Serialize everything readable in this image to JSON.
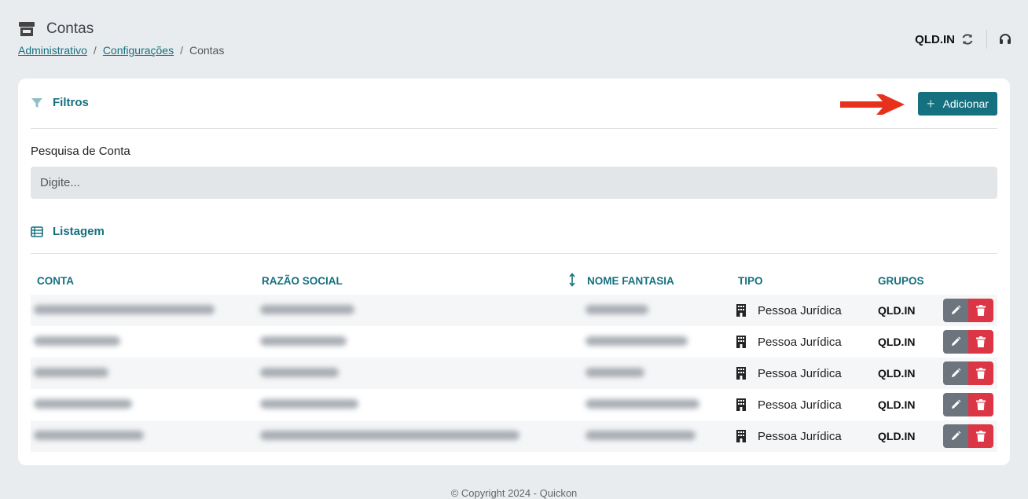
{
  "page": {
    "title": "Contas",
    "breadcrumb": [
      {
        "label": "Administrativo"
      },
      {
        "label": "Configurações"
      },
      {
        "label": "Contas"
      }
    ],
    "breadcrumb_separator": "/"
  },
  "top_right": {
    "org": "QLD.IN"
  },
  "filters": {
    "heading": "Filtros",
    "add_button": "Adicionar",
    "search_label": "Pesquisa de Conta",
    "search_placeholder": "Digite..."
  },
  "listing": {
    "heading": "Listagem",
    "columns": [
      "CONTA",
      "RAZÃO SOCIAL",
      "NOME FANTASIA",
      "TIPO",
      "GRUPOS"
    ],
    "rows": [
      {
        "tipo": "Pessoa Jurídica",
        "grupo": "QLD.IN"
      },
      {
        "tipo": "Pessoa Jurídica",
        "grupo": "QLD.IN"
      },
      {
        "tipo": "Pessoa Jurídica",
        "grupo": "QLD.IN"
      },
      {
        "tipo": "Pessoa Jurídica",
        "grupo": "QLD.IN"
      },
      {
        "tipo": "Pessoa Jurídica",
        "grupo": "QLD.IN"
      }
    ]
  },
  "footer": {
    "text": "© Copyright 2024 - Quickon"
  },
  "colors": {
    "accent": "#15707f",
    "delete": "#dc3545",
    "edit": "#6c757d",
    "arrow": "#e8311c",
    "background": "#e9ecef"
  },
  "icons": [
    "store-icon",
    "refresh-icon",
    "support-icon",
    "filter-icon",
    "list-icon",
    "sort-icon",
    "building-icon",
    "pencil-icon",
    "trash-icon",
    "plus-icon"
  ]
}
